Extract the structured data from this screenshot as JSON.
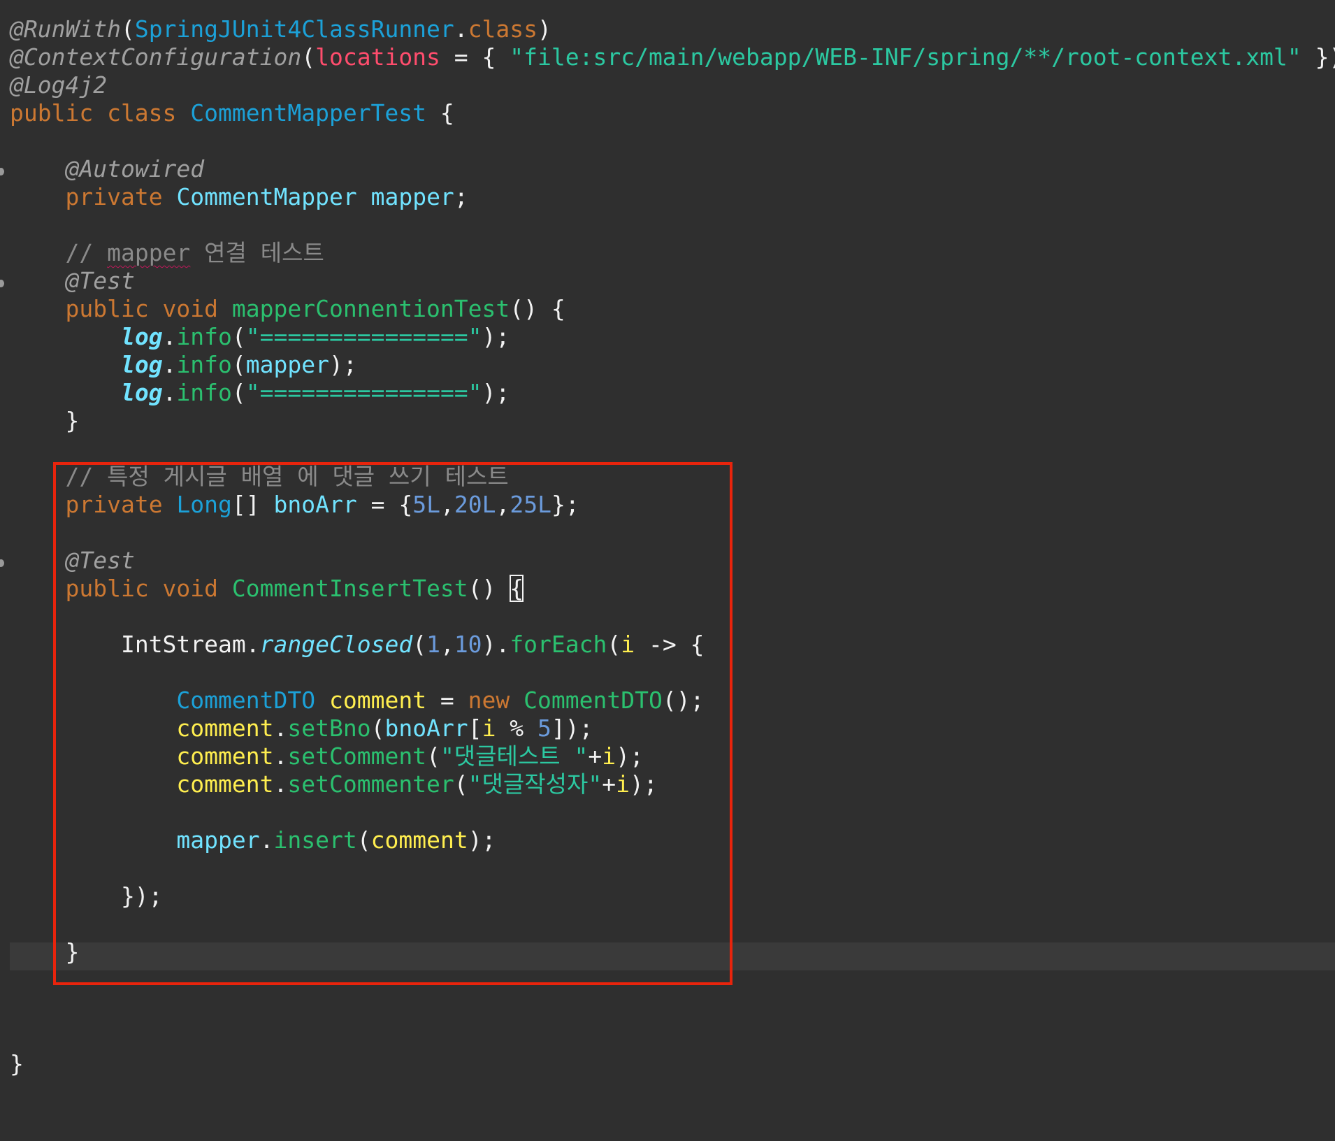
{
  "editor": {
    "lines": [
      [
        [
          "@RunWith",
          "ann"
        ],
        [
          "(",
          "plain"
        ],
        [
          "SpringJUnit4ClassRunner",
          "cls"
        ],
        [
          ".",
          "plain"
        ],
        [
          "class",
          "kw"
        ],
        [
          ")",
          "plain"
        ]
      ],
      [
        [
          "@ContextConfiguration",
          "ann"
        ],
        [
          "(",
          "plain"
        ],
        [
          "locations",
          "attr"
        ],
        [
          " = { ",
          "plain"
        ],
        [
          "\"file:src/main/webapp/WEB-INF/spring/**/root-context.xml\"",
          "str"
        ],
        [
          " })",
          "plain"
        ]
      ],
      [
        [
          "@Log4j2",
          "ann"
        ]
      ],
      [
        [
          "public class ",
          "kw"
        ],
        [
          "CommentMapperTest",
          "cls"
        ],
        [
          " {",
          "plain"
        ]
      ],
      [],
      [
        [
          "    ",
          "plain"
        ],
        [
          "@Autowired",
          "ann"
        ]
      ],
      [
        [
          "    ",
          "plain"
        ],
        [
          "private ",
          "kw"
        ],
        [
          "CommentMapper",
          "var"
        ],
        [
          " ",
          "plain"
        ],
        [
          "mapper",
          "fld"
        ],
        [
          ";",
          "plain"
        ]
      ],
      [],
      [
        [
          "    ",
          "plain"
        ],
        [
          "// ",
          "cmt"
        ],
        [
          "mapper",
          "cmt spell"
        ],
        [
          " 연결 테스트",
          "cmt"
        ]
      ],
      [
        [
          "    ",
          "plain"
        ],
        [
          "@Test",
          "ann"
        ]
      ],
      [
        [
          "    ",
          "plain"
        ],
        [
          "public void ",
          "kw"
        ],
        [
          "mapperConnentionTest",
          "meth"
        ],
        [
          "() {",
          "plain"
        ]
      ],
      [
        [
          "        ",
          "plain"
        ],
        [
          "log",
          "stat"
        ],
        [
          ".",
          "plain"
        ],
        [
          "info",
          "meth"
        ],
        [
          "(",
          "plain"
        ],
        [
          "\"===============\"",
          "str"
        ],
        [
          ");",
          "plain"
        ]
      ],
      [
        [
          "        ",
          "plain"
        ],
        [
          "log",
          "stat"
        ],
        [
          ".",
          "plain"
        ],
        [
          "info",
          "meth"
        ],
        [
          "(",
          "plain"
        ],
        [
          "mapper",
          "fld"
        ],
        [
          ");",
          "plain"
        ]
      ],
      [
        [
          "        ",
          "plain"
        ],
        [
          "log",
          "stat"
        ],
        [
          ".",
          "plain"
        ],
        [
          "info",
          "meth"
        ],
        [
          "(",
          "plain"
        ],
        [
          "\"===============\"",
          "str"
        ],
        [
          ");",
          "plain"
        ]
      ],
      [
        [
          "    }",
          "plain"
        ]
      ],
      [],
      [
        [
          "    ",
          "plain"
        ],
        [
          "// 특정 게시글 배열 에 댓글 쓰기 테스트",
          "cmt"
        ]
      ],
      [
        [
          "    ",
          "plain"
        ],
        [
          "private ",
          "kw"
        ],
        [
          "Long",
          "type"
        ],
        [
          "[] ",
          "plain"
        ],
        [
          "bnoArr",
          "fld"
        ],
        [
          " = {",
          "plain"
        ],
        [
          "5L",
          "num"
        ],
        [
          ",",
          "plain"
        ],
        [
          "20L",
          "num"
        ],
        [
          ",",
          "plain"
        ],
        [
          "25L",
          "num"
        ],
        [
          "};",
          "plain"
        ]
      ],
      [],
      [
        [
          "    ",
          "plain"
        ],
        [
          "@Test",
          "ann"
        ]
      ],
      [
        [
          "    ",
          "plain"
        ],
        [
          "public void ",
          "kw"
        ],
        [
          "CommentInsertTest",
          "meth"
        ],
        [
          "() ",
          "plain"
        ],
        [
          "{",
          "plain cursor"
        ]
      ],
      [],
      [
        [
          "        ",
          "plain"
        ],
        [
          "IntStream",
          "plain"
        ],
        [
          ".",
          "plain"
        ],
        [
          "rangeClosed",
          "smeth"
        ],
        [
          "(",
          "plain"
        ],
        [
          "1",
          "num"
        ],
        [
          ",",
          "plain"
        ],
        [
          "10",
          "num"
        ],
        [
          ").",
          "plain"
        ],
        [
          "forEach",
          "meth"
        ],
        [
          "(",
          "plain"
        ],
        [
          "i",
          "lvar"
        ],
        [
          " -> {",
          "plain"
        ]
      ],
      [],
      [
        [
          "            ",
          "plain"
        ],
        [
          "CommentDTO",
          "type"
        ],
        [
          " ",
          "plain"
        ],
        [
          "comment",
          "lvar"
        ],
        [
          " = ",
          "plain"
        ],
        [
          "new ",
          "kw"
        ],
        [
          "CommentDTO",
          "meth"
        ],
        [
          "();",
          "plain"
        ]
      ],
      [
        [
          "            ",
          "plain"
        ],
        [
          "comment",
          "lvar"
        ],
        [
          ".",
          "plain"
        ],
        [
          "setBno",
          "meth"
        ],
        [
          "(",
          "plain"
        ],
        [
          "bnoArr",
          "fld"
        ],
        [
          "[",
          "plain"
        ],
        [
          "i",
          "lvar"
        ],
        [
          " % ",
          "plain"
        ],
        [
          "5",
          "num"
        ],
        [
          "]);",
          "plain"
        ]
      ],
      [
        [
          "            ",
          "plain"
        ],
        [
          "comment",
          "lvar"
        ],
        [
          ".",
          "plain"
        ],
        [
          "setComment",
          "meth"
        ],
        [
          "(",
          "plain"
        ],
        [
          "\"댓글테스트 \"",
          "str"
        ],
        [
          "+",
          "plain"
        ],
        [
          "i",
          "lvar"
        ],
        [
          ");",
          "plain"
        ]
      ],
      [
        [
          "            ",
          "plain"
        ],
        [
          "comment",
          "lvar"
        ],
        [
          ".",
          "plain"
        ],
        [
          "setCommenter",
          "meth"
        ],
        [
          "(",
          "plain"
        ],
        [
          "\"댓글작성자\"",
          "str"
        ],
        [
          "+",
          "plain"
        ],
        [
          "i",
          "lvar"
        ],
        [
          ");",
          "plain"
        ]
      ],
      [],
      [
        [
          "            ",
          "plain"
        ],
        [
          "mapper",
          "fld"
        ],
        [
          ".",
          "plain"
        ],
        [
          "insert",
          "meth"
        ],
        [
          "(",
          "plain"
        ],
        [
          "comment",
          "lvar"
        ],
        [
          ");",
          "plain"
        ]
      ],
      [],
      [
        [
          "        });",
          "plain"
        ]
      ],
      [],
      [
        [
          "    }",
          "plain"
        ]
      ],
      [],
      [],
      [],
      [
        [
          "}",
          "plain"
        ]
      ]
    ]
  }
}
